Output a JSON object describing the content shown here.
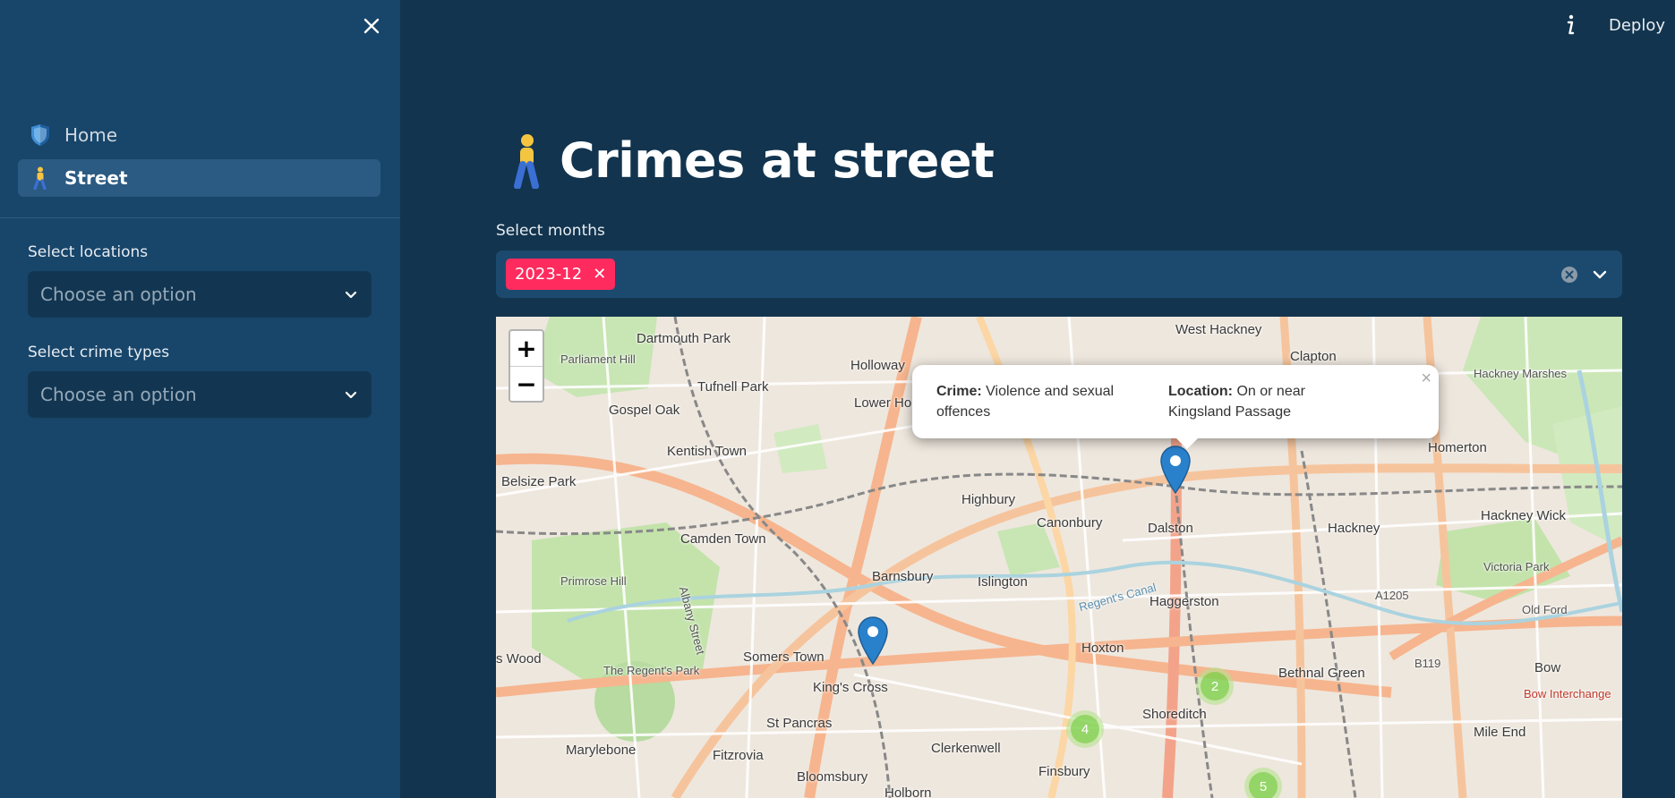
{
  "sidebar": {
    "nav": [
      {
        "label": "Home",
        "icon": "shield-icon"
      },
      {
        "label": "Street",
        "icon": "person-walking-icon",
        "active": true
      }
    ],
    "filters": [
      {
        "label": "Select locations",
        "placeholder": "Choose an option"
      },
      {
        "label": "Select crime types",
        "placeholder": "Choose an option"
      }
    ]
  },
  "header": {
    "deploy_label": "Deploy"
  },
  "main": {
    "title": "Crimes at street",
    "months": {
      "label": "Select months",
      "selected": [
        "2023-12"
      ]
    },
    "map": {
      "zoom_in": "+",
      "zoom_out": "−",
      "popup": {
        "crime_key": "Crime:",
        "crime_value": "Violence and sexual offences",
        "location_key": "Location:",
        "location_value": "On or near Kingsland Passage",
        "close": "×"
      },
      "clusters": [
        "2",
        "4",
        "5"
      ],
      "places": [
        "Dartmouth Park",
        "Tufnell Park",
        "Holloway",
        "Lower Ho",
        "West Hackney",
        "Clapton",
        "Hackney Marshes",
        "Parliament Hill",
        "Gospel Oak",
        "Kentish Town",
        "Homerton",
        "Belsize Park",
        "Highbury",
        "Canonbury",
        "Dalston",
        "Hackney",
        "Hackney Wick",
        "Camden Town",
        "Barnsbury",
        "Islington",
        "Haggerston",
        "Victoria Park",
        "Primrose Hill",
        "A1205",
        "Old Ford",
        "Somers Town",
        "Hoxton",
        "s Wood",
        "The Regent's Park",
        "Bethnal Green",
        "B119",
        "Bow",
        "King's Cross",
        "Shoreditch",
        "St Pancras",
        "Mile End",
        "Marylebone",
        "Fitzrovia",
        "Clerkenwell",
        "Finsbury",
        "Bloomsbury",
        "Holborn",
        "Albany Street",
        "Regent's Canal",
        "Bow Interchange"
      ]
    }
  },
  "colors": {
    "sidebar_bg": "#18456a",
    "main_bg": "#12344e",
    "chip": "#ff2b5e",
    "marker": "#2a81cb",
    "cluster": "#6ecc39"
  }
}
